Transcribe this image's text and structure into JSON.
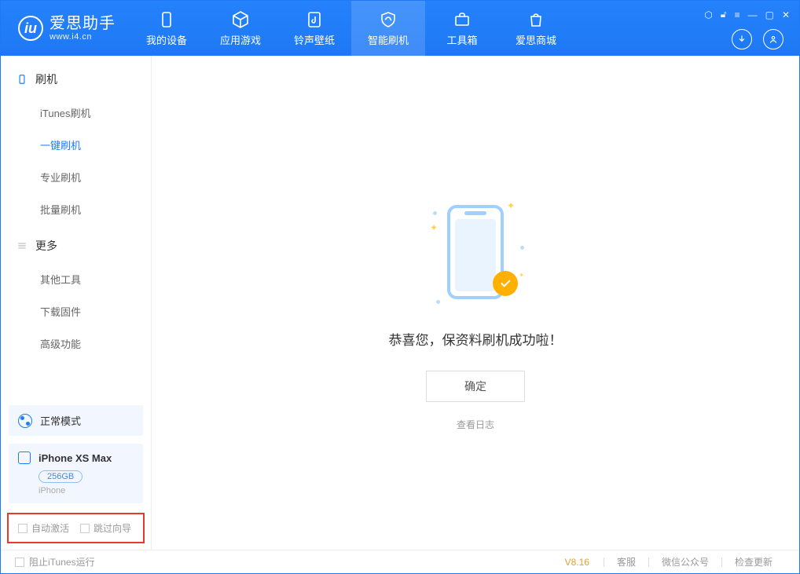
{
  "app": {
    "title": "爱思助手",
    "subtitle": "www.i4.cn"
  },
  "tabs": {
    "device": "我的设备",
    "apps": "应用游戏",
    "ringtone": "铃声壁纸",
    "flash": "智能刷机",
    "toolbox": "工具箱",
    "store": "爱思商城"
  },
  "sidebar": {
    "section1": {
      "title": "刷机",
      "items": {
        "itunes": "iTunes刷机",
        "oneclick": "一键刷机",
        "pro": "专业刷机",
        "batch": "批量刷机"
      }
    },
    "section2": {
      "title": "更多",
      "items": {
        "other": "其他工具",
        "firmware": "下载固件",
        "advanced": "高级功能"
      }
    }
  },
  "mode": {
    "label": "正常模式"
  },
  "device": {
    "name": "iPhone XS Max",
    "capacity": "256GB",
    "type": "iPhone"
  },
  "options": {
    "auto_activate": "自动激活",
    "skip_guide": "跳过向导"
  },
  "main": {
    "success": "恭喜您，保资料刷机成功啦！",
    "confirm": "确定",
    "view_log": "查看日志"
  },
  "footer": {
    "block_itunes": "阻止iTunes运行",
    "version": "V8.16",
    "support": "客服",
    "wechat": "微信公众号",
    "update": "检查更新"
  }
}
